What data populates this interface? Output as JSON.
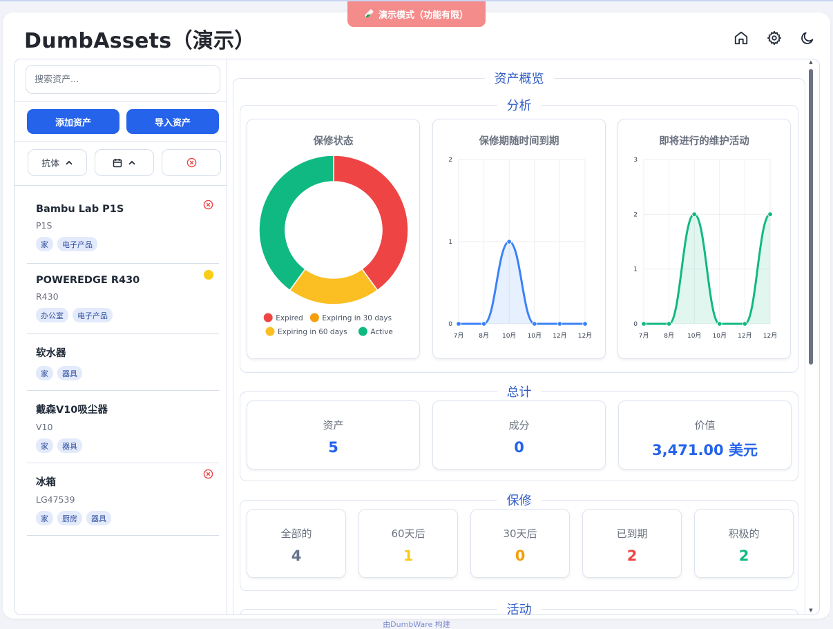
{
  "banner": {
    "text": "演示模式（功能有限）",
    "color": "#f58c8c"
  },
  "app": {
    "title": "DumbAssets（演示）"
  },
  "header": {
    "icons": [
      "home-icon",
      "gear-icon",
      "moon-icon"
    ]
  },
  "sidebar": {
    "search_placeholder": "搜索资产...",
    "add_button": "添加资产",
    "import_button": "导入资产",
    "filters": {
      "sort_label": "抗体"
    },
    "assets": [
      {
        "name": "Bambu Lab P1S",
        "model": "P1S",
        "tags": [
          "家",
          "电子产品"
        ],
        "status": "expired"
      },
      {
        "name": "POWEREDGE R430",
        "model": "R430",
        "tags": [
          "办公室",
          "电子产品"
        ],
        "status": "expiring"
      },
      {
        "name": "软水器",
        "model": "",
        "tags": [
          "家",
          "器具"
        ],
        "status": "none"
      },
      {
        "name": "戴森V10吸尘器",
        "model": "V10",
        "tags": [
          "家",
          "器具"
        ],
        "status": "none"
      },
      {
        "name": "冰箱",
        "model": "LG47539",
        "tags": [
          "家",
          "厨房",
          "器具"
        ],
        "status": "expired"
      }
    ]
  },
  "overview": {
    "title": "资产概览",
    "analysis_title": "分析",
    "totals_title": "总计",
    "warranty_title": "保修",
    "activity_title": "活动"
  },
  "chart_data": [
    {
      "type": "pie",
      "title": "保修状态",
      "labels": [
        "Expired",
        "Expiring in 30 days",
        "Expiring in 60 days",
        "Active"
      ],
      "values": [
        2,
        0,
        1,
        2
      ],
      "colors": [
        "#ef4444",
        "#f59e0b",
        "#fbbf24",
        "#10b981"
      ],
      "legend": "bottom"
    },
    {
      "type": "area",
      "title": "保修期随时间到期",
      "categories": [
        "7月",
        "8月",
        "10月",
        "10月",
        "12月",
        "12月"
      ],
      "values": [
        0,
        0,
        1,
        0,
        0,
        0
      ],
      "ylim": [
        0,
        2
      ],
      "yticks": [
        "0",
        "1",
        "2"
      ],
      "color": "#3b82f6",
      "grid": true
    },
    {
      "type": "area",
      "title": "即将进行的维护活动",
      "categories": [
        "7月",
        "8月",
        "10月",
        "10月",
        "12月",
        "12月"
      ],
      "values": [
        0,
        0,
        2,
        0,
        0,
        2
      ],
      "ylim": [
        0,
        3
      ],
      "yticks": [
        "0",
        "1",
        "2",
        "3"
      ],
      "color": "#10b981",
      "grid": true
    }
  ],
  "totals": [
    {
      "label": "资产",
      "value": "5",
      "color": "#2563eb"
    },
    {
      "label": "成分",
      "value": "0",
      "color": "#2563eb"
    },
    {
      "label": "价值",
      "value": "3,471.00 美元",
      "color": "#2563eb"
    }
  ],
  "warranty": [
    {
      "label": "全部的",
      "value": "4",
      "color": "#64748b"
    },
    {
      "label": "60天后",
      "value": "1",
      "color": "#facc15"
    },
    {
      "label": "30天后",
      "value": "0",
      "color": "#f59e0b"
    },
    {
      "label": "已到期",
      "value": "2",
      "color": "#ef4444"
    },
    {
      "label": "积极的",
      "value": "2",
      "color": "#10b981"
    }
  ],
  "footer": {
    "text": "由DumbWare 构建"
  }
}
